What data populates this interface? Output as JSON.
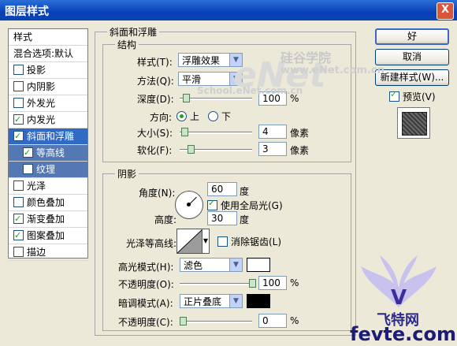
{
  "window": {
    "title": "图层样式",
    "close_glyph": "X"
  },
  "styles_list": [
    {
      "label": "样式",
      "kind": "head"
    },
    {
      "label": "混合选项:默认",
      "kind": "head"
    },
    {
      "label": "投影",
      "checked": false
    },
    {
      "label": "内阴影",
      "checked": false
    },
    {
      "label": "外发光",
      "checked": false
    },
    {
      "label": "内发光",
      "checked": true
    },
    {
      "label": "斜面和浮雕",
      "checked": true,
      "selected": true
    },
    {
      "label": "等高线",
      "checked": true,
      "sub": true
    },
    {
      "label": "纹理",
      "checked": false,
      "sub": true
    },
    {
      "label": "光泽",
      "checked": false
    },
    {
      "label": "颜色叠加",
      "checked": false
    },
    {
      "label": "渐变叠加",
      "checked": true
    },
    {
      "label": "图案叠加",
      "checked": true
    },
    {
      "label": "描边",
      "checked": false
    }
  ],
  "bevel": {
    "section_title": "斜面和浮雕",
    "structure": {
      "title": "结构",
      "style_label": "样式(T):",
      "style_value": "浮雕效果",
      "technique_label": "方法(Q):",
      "technique_value": "平滑",
      "depth_label": "深度(D):",
      "depth_value": "100",
      "depth_unit": "%",
      "direction_label": "方向:",
      "direction_up": "上",
      "direction_down": "下",
      "size_label": "大小(S):",
      "size_value": "4",
      "size_unit": "像素",
      "soften_label": "软化(F):",
      "soften_value": "3",
      "soften_unit": "像素"
    },
    "shading": {
      "title": "阴影",
      "angle_label": "角度(N):",
      "angle_value": "60",
      "angle_unit": "度",
      "global_light_label": "使用全局光(G)",
      "altitude_label": "高度:",
      "altitude_value": "30",
      "altitude_unit": "度",
      "gloss_label": "光泽等高线:",
      "antialias_label": "消除锯齿(L)",
      "highlight_mode_label": "高光模式(H):",
      "highlight_mode_value": "滤色",
      "highlight_color": "#ffffff",
      "highlight_opacity_label": "不透明度(O):",
      "highlight_opacity_value": "100",
      "highlight_opacity_unit": "%",
      "shadow_mode_label": "暗调模式(A):",
      "shadow_mode_value": "正片叠底",
      "shadow_color": "#000000",
      "shadow_opacity_label": "不透明度(C):",
      "shadow_opacity_value": "0",
      "shadow_opacity_unit": "%"
    }
  },
  "buttons": {
    "ok": "好",
    "cancel": "取消",
    "new_style": "新建样式(W)...",
    "preview": "预览(V)"
  },
  "watermarks": {
    "enet": "eNet",
    "enet_cn": "硅谷学院",
    "enet_url": "www.eNet.com.cn",
    "school": "School.eNet.com.cn",
    "fevte_cn": "飞特网",
    "fevte": "fevte.com"
  }
}
